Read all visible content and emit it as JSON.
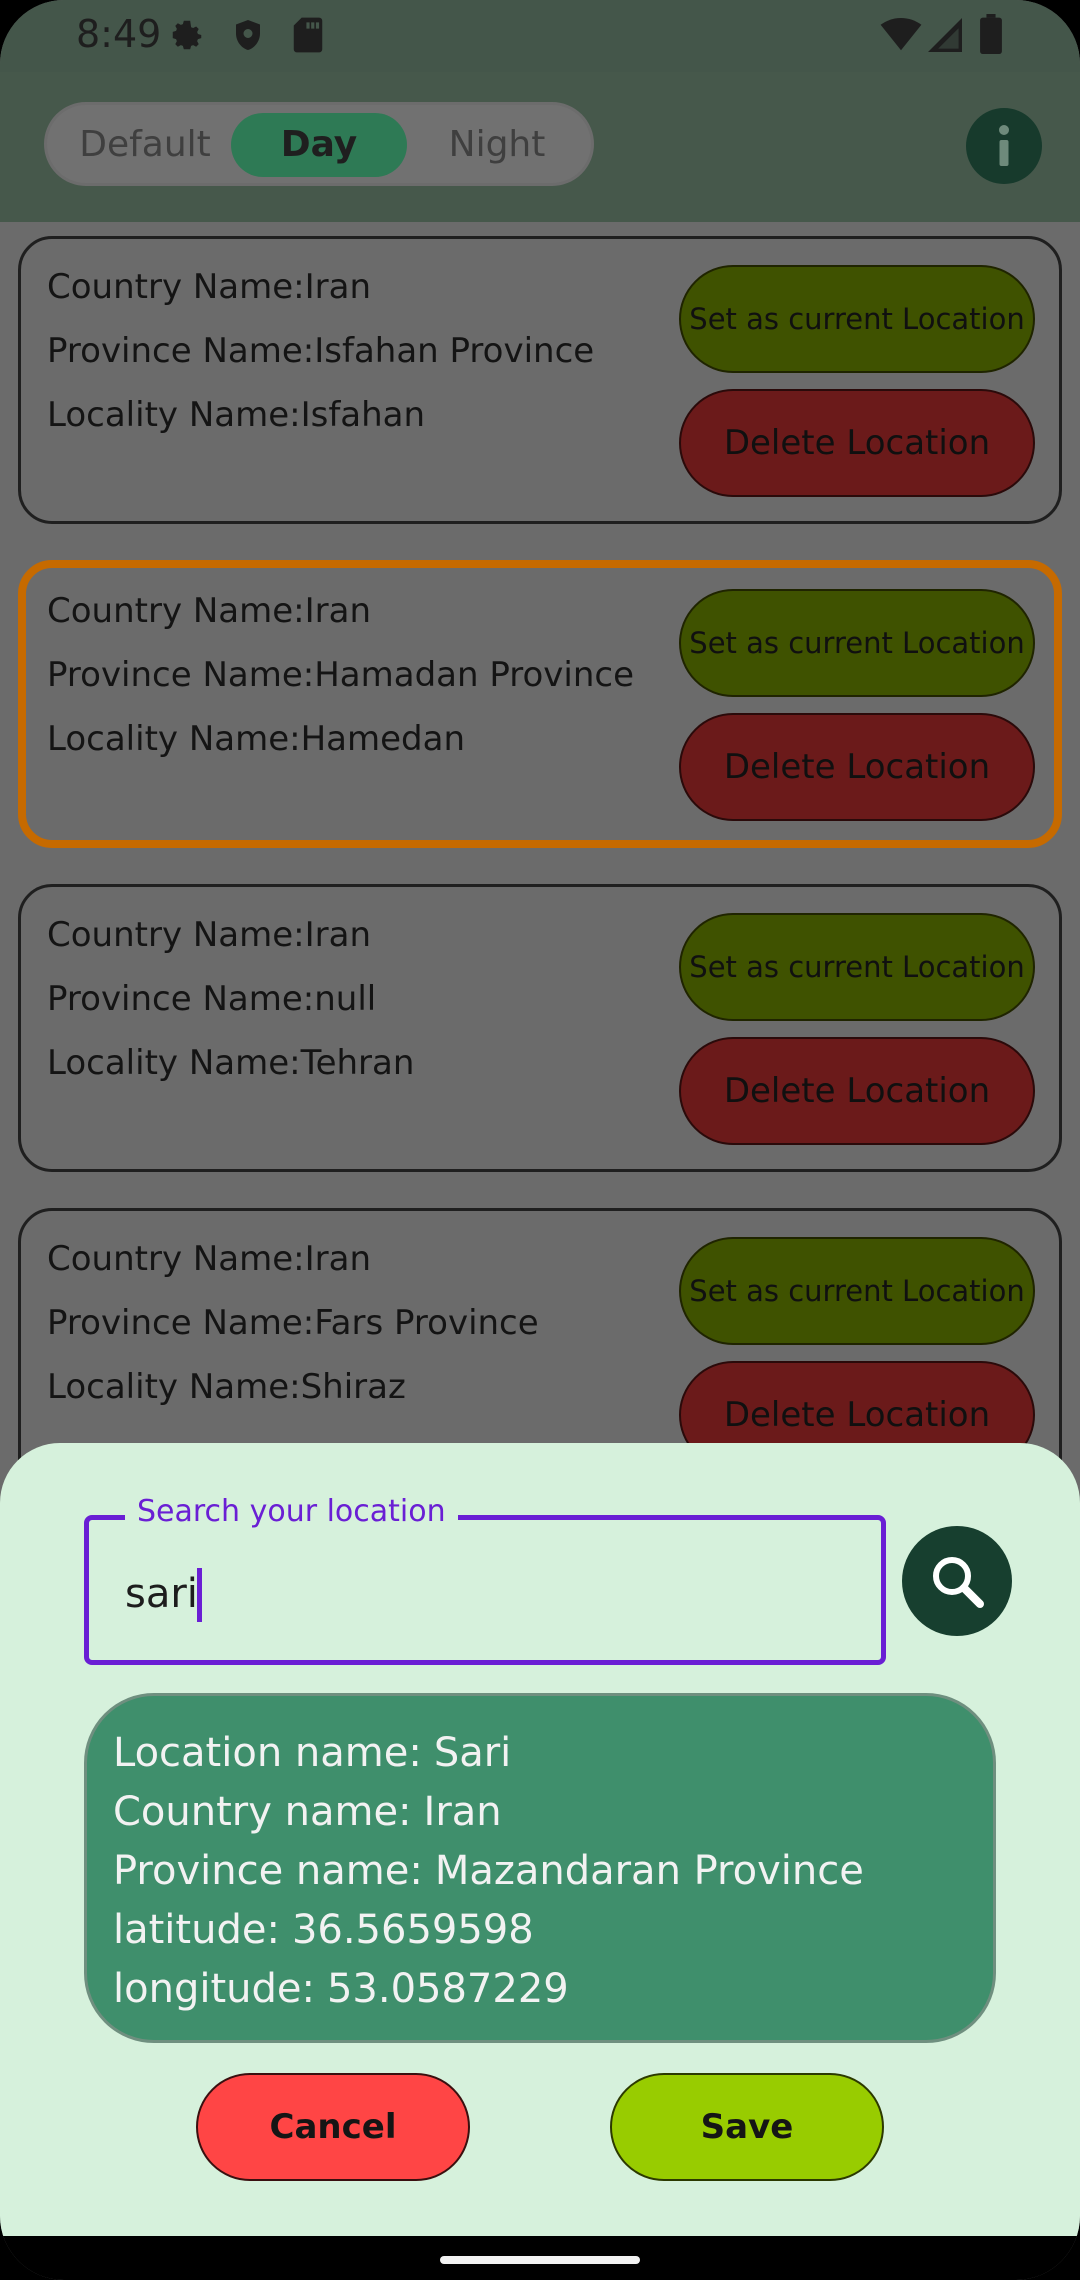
{
  "status_bar": {
    "time": "8:49",
    "left_icons": [
      "gear-icon",
      "shield-icon",
      "sd-card-icon"
    ],
    "right_icons": [
      "wifi-icon",
      "signal-icon",
      "battery-icon"
    ]
  },
  "theme_toggle": {
    "options": [
      {
        "label": "Default",
        "active": false
      },
      {
        "label": "Day",
        "active": true
      },
      {
        "label": "Night",
        "active": false
      }
    ]
  },
  "info_button": {
    "icon": "info-icon"
  },
  "locations": [
    {
      "country": "Country Name:Iran",
      "province": "Province Name:Isfahan Province",
      "locality": "Locality Name:Isfahan",
      "selected": false,
      "set_label": "Set as current Location",
      "delete_label": "Delete Location"
    },
    {
      "country": "Country Name:Iran",
      "province": "Province Name:Hamadan Province",
      "locality": "Locality Name:Hamedan",
      "selected": true,
      "set_label": "Set as current Location",
      "delete_label": "Delete Location"
    },
    {
      "country": "Country Name:Iran",
      "province": "Province Name:null",
      "locality": "Locality Name:Tehran",
      "selected": false,
      "set_label": "Set as current Location",
      "delete_label": "Delete Location"
    },
    {
      "country": "Country Name:Iran",
      "province": "Province Name:Fars Province",
      "locality": "Locality Name:Shiraz",
      "selected": false,
      "set_label": "Set as current Location",
      "delete_label": "Delete Location"
    }
  ],
  "sheet": {
    "search_label": "Search your location",
    "search_value": "sari",
    "search_icon": "search-icon",
    "result": {
      "location_key": "Location name:",
      "location_val": "Sari",
      "country_key": "Country name:",
      "country_val": "Iran",
      "province_key": "Province name:",
      "province_val": "Mazandaran Province",
      "lat_key": "latitude:",
      "lat_val": "36.5659598",
      "lon_key": "longitude:",
      "lon_val": "53.0587229"
    },
    "cancel_label": "Cancel",
    "save_label": "Save"
  },
  "colors": {
    "accent": "#6a1fd4",
    "selected_border": "#c66a00",
    "result_bg": "#3f8f6c",
    "cancel": "#ff4545",
    "save": "#98cc00"
  }
}
